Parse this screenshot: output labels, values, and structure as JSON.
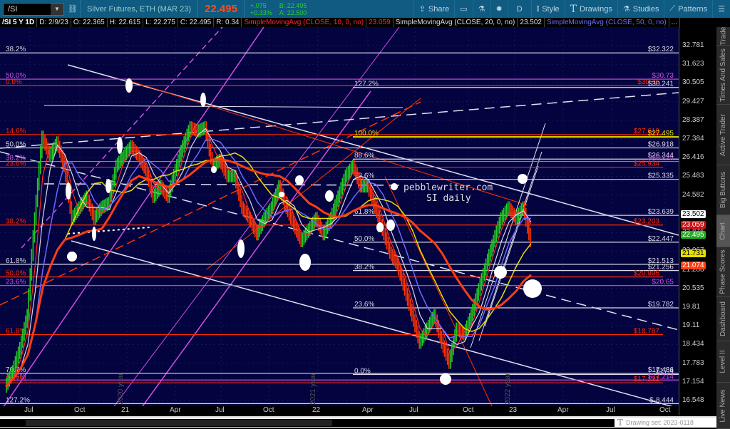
{
  "toolbar": {
    "symbol": "/SI",
    "description": "Silver Futures, ETH (MAR 23)",
    "last": "22.495",
    "change": "+.075",
    "change_pct": "+0.33%",
    "bid": "B: 22.495",
    "ask": "A: 22.500",
    "share": "Share",
    "period": "D",
    "style": "Style",
    "drawings": "Drawings",
    "studies": "Studies",
    "patterns": "Patterns"
  },
  "legend": {
    "title": "/SI 5 Y 1D",
    "date": "D: 2/9/23",
    "open": "O: 22.365",
    "high": "H: 22.615",
    "low": "L: 22.275",
    "close": "C: 22.495",
    "range": "R: 0.34",
    "sma10": "SimpleMovingAvg (CLOSE, 10, 0, no)",
    "sma10_val": "23.059",
    "sma20": "SimpleMovingAvg (CLOSE, 20, 0, no)",
    "sma20_val": "23.502",
    "sma50": "SimpleMovingAvg (CLOSE, 50, 0, no)",
    "more": "..."
  },
  "tabs": [
    "Trade",
    "Times And Sales",
    "Active Trader",
    "Big Buttons",
    "Chart",
    "Phase Scores",
    "Dashboard",
    "Level II",
    "Live News"
  ],
  "active_tab": "Chart",
  "drawing_set": "Drawing set: 2023-0118",
  "colors": {
    "bg": "#03033f",
    "white": "#d8d8e8",
    "red": "#ff2a00",
    "magenta": "#d050e0",
    "yellow": "#e8e000",
    "blue": "#6a6aff"
  },
  "chart_data": {
    "type": "line",
    "title": "/SI 5 Y 1D",
    "watermark": [
      "pebblewriter.com",
      "SI daily"
    ],
    "year_markers": [
      "2020 year",
      "2021 year",
      "2022 year"
    ],
    "x_ticks": [
      "Jul",
      "Oct",
      "21",
      "Apr",
      "Jul",
      "Oct",
      "22",
      "Apr",
      "Jul",
      "Oct",
      "23",
      "Apr",
      "Jul",
      "Oct"
    ],
    "y_ticks": [
      32.781,
      31.623,
      30.505,
      29.427,
      28.387,
      27.384,
      26.416,
      25.483,
      24.582,
      23.714,
      22.876,
      22.067,
      21.288,
      20.535,
      19.81,
      19.11,
      18.434,
      17.783,
      17.154,
      16.548
    ],
    "ylim": [
      16.3,
      33.2
    ],
    "closes": [
      17.0,
      17.5,
      18.3,
      19.5,
      23.5,
      27.5,
      26.5,
      27.2,
      26.0,
      23.5,
      24.0,
      24.5,
      23.5,
      24.0,
      24.2,
      26.0,
      26.5,
      27.0,
      26.5,
      25.8,
      24.5,
      25.0,
      24.5,
      25.8,
      27.0,
      28.0,
      27.8,
      28.0,
      26.0,
      26.3,
      25.5,
      25.5,
      24.0,
      23.5,
      22.8,
      23.5,
      24.0,
      25.0,
      24.0,
      23.2,
      22.5,
      23.0,
      23.5,
      22.8,
      23.5,
      24.5,
      25.5,
      26.0,
      25.0,
      25.0,
      24.0,
      23.0,
      22.0,
      21.5,
      20.5,
      19.5,
      18.5,
      19.0,
      19.5,
      18.5,
      17.8,
      19.0,
      18.8,
      19.5,
      20.5,
      21.5,
      22.5,
      23.5,
      24.0,
      23.5,
      24.0,
      22.5
    ],
    "price_badges": [
      {
        "value": "23.502",
        "bg": "#ffffff",
        "fg": "#000"
      },
      {
        "value": "23.059",
        "bg": "#d01010",
        "fg": "#fff"
      },
      {
        "value": "22.495",
        "bg": "#1fae1f",
        "fg": "#fff"
      },
      {
        "value": "21.731",
        "bg": "#e8e000",
        "fg": "#000"
      },
      {
        "value": "21.074",
        "bg": "#ff3d10",
        "fg": "#fff"
      }
    ],
    "levels": [
      {
        "price": 32.322,
        "color": "white",
        "left": "38.2%",
        "right": "$32.322"
      },
      {
        "price": 30.73,
        "color": "magenta",
        "left": "50.0%",
        "right": "$30.73"
      },
      {
        "price": 30.35,
        "color": "red",
        "left": "0.0%",
        "right": "$30.35"
      },
      {
        "price": 30.241,
        "color": "white",
        "mid": "127.2%",
        "right": "$30.241"
      },
      {
        "price": 27.618,
        "color": "red",
        "left": "14.6%",
        "right": "$27.618"
      },
      {
        "price": 27.495,
        "color": "yellow",
        "mid": "100.0%",
        "right": "$27.495"
      },
      {
        "price": 26.918,
        "color": "white",
        "left": "50.0%",
        "right": "$26.918"
      },
      {
        "price": 26.344,
        "color": "white",
        "mid": "88.6%",
        "right": "$26.344"
      },
      {
        "price": 26.225,
        "color": "magenta",
        "left": "38.2%",
        "right": "$26.225"
      },
      {
        "price": 25.934,
        "color": "red",
        "left": "23.6%",
        "right": "$25.934"
      },
      {
        "price": 25.335,
        "color": "white",
        "mid": "78.6%",
        "right": "$25.335"
      },
      {
        "price": 23.639,
        "color": "white",
        "mid": "61.8%",
        "right": "$23.639"
      },
      {
        "price": 23.203,
        "color": "red",
        "left": "38.2%",
        "right": "$23.203"
      },
      {
        "price": 22.447,
        "color": "white",
        "mid": "50.0%",
        "right": "$22.447"
      },
      {
        "price": 21.513,
        "color": "white",
        "left": "61.8%",
        "right": "$21.513"
      },
      {
        "price": 21.256,
        "color": "white",
        "mid": "38.2%",
        "right": "$21.256"
      },
      {
        "price": 20.995,
        "color": "red",
        "left": "50.0%",
        "right": "$20.995"
      },
      {
        "price": 20.65,
        "color": "magenta",
        "left": "23.6%",
        "right": "$20.65"
      },
      {
        "price": 19.782,
        "color": "white",
        "mid": "23.6%",
        "right": "$19.782"
      },
      {
        "price": 18.787,
        "color": "red",
        "left": "61.8%",
        "right": "$18.787"
      },
      {
        "price": 17.436,
        "color": "white",
        "left": "70.7%",
        "right": "$17.436"
      },
      {
        "price": 17.4,
        "color": "white",
        "mid": "0.0%",
        "right": "$17.4"
      },
      {
        "price": 17.214,
        "color": "magenta",
        "left": "14.6%",
        "right": "$17.214"
      },
      {
        "price": 17.122,
        "color": "red",
        "left": "70.7%",
        "right": "$17.122"
      },
      {
        "price": 16.45,
        "color": "white",
        "left": "127.2%",
        "right": "$-8.444"
      }
    ]
  }
}
